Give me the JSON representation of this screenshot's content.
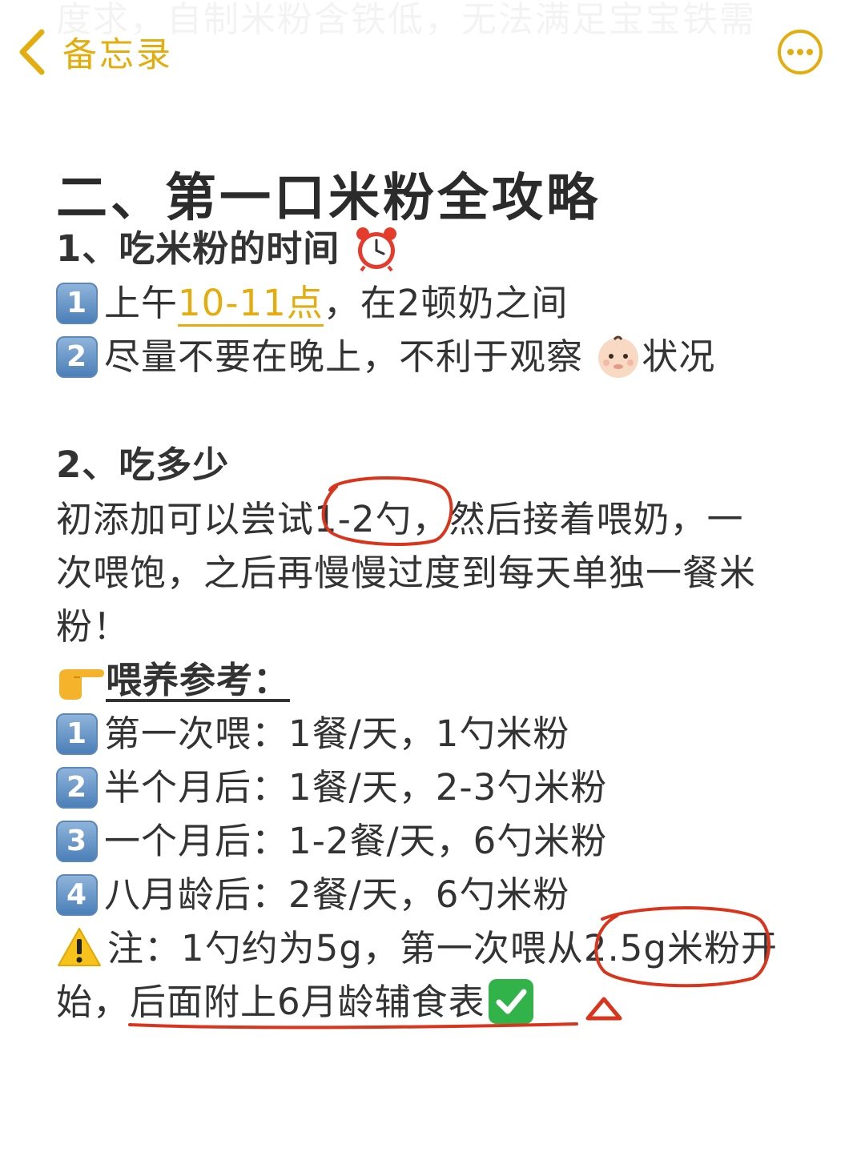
{
  "ghost_text": "度求，自制米粉含铁低，无法满足宝宝铁需",
  "nav": {
    "back_label": "备忘录",
    "accent": "#e3ad0e"
  },
  "title": "二、第一口米粉全攻略",
  "section1": {
    "heading": "1、吃米粉的时间",
    "heading_icon": "alarm-clock-icon",
    "item1_badge": "1",
    "item1_before": "上午",
    "item1_highlight": "10-11点",
    "item1_after": "，在2顿奶之间",
    "item2_badge": "2",
    "item2_before": "尽量不要在晚上，不利于观察",
    "item2_icon": "baby-face-icon",
    "item2_after": "状况"
  },
  "section2": {
    "heading": "2、吃多少",
    "para_line1": "初添加可以尝试1-2勺，然后接着喂奶，一",
    "para_line2": "次喂饱，之后再慢慢过度到每天单独一餐米",
    "para_line3": "粉！",
    "ref_icon": "pointing-hand-icon",
    "ref_heading": "喂养参考：",
    "steps": [
      {
        "badge": "1",
        "text": "第一次喂：1餐/天，1勺米粉"
      },
      {
        "badge": "2",
        "text": "半个月后：1餐/天，2-3勺米粉"
      },
      {
        "badge": "3",
        "text": "一个月后：1-2餐/天，6勺米粉"
      },
      {
        "badge": "4",
        "text": "八月龄后：2餐/天，6勺米粉"
      }
    ],
    "note_icon": "warning-icon",
    "note_line1": "注：1勺约为5g，第一次喂从2.5g米粉开",
    "note_line2": "始，后面附上6月龄辅食表",
    "note_end_icon": "check-mark-icon"
  },
  "colors": {
    "annotation_red": "#d9341c",
    "text": "#333333",
    "keycap_blue": "#4b7fb8",
    "check_green": "#31b349"
  }
}
